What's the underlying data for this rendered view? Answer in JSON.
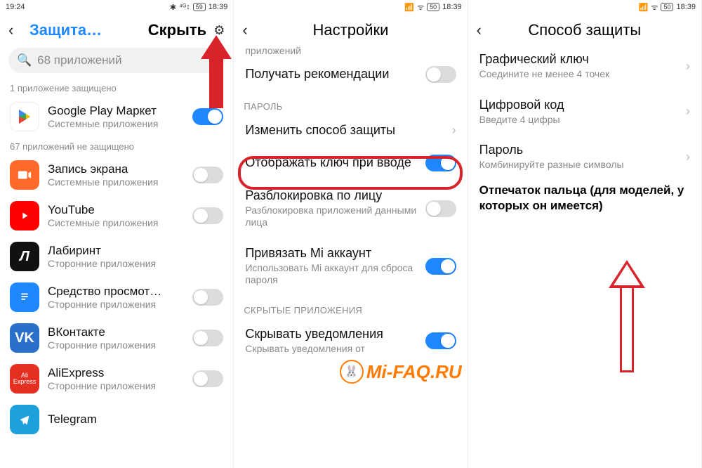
{
  "panel1": {
    "status": {
      "time_left": "19:24",
      "time_right": "18:39",
      "battery": "59"
    },
    "header": {
      "back": "‹",
      "tab_active": "Защита…",
      "tab_other": "Скрыть"
    },
    "search": {
      "placeholder": "68 приложений"
    },
    "protected_label": "1 приложение защищено",
    "unprotected_label": "67 приложений не защищено",
    "apps": [
      {
        "name": "Google Play Маркет",
        "sub": "Системные приложения",
        "toggle": true,
        "icon": "play"
      },
      {
        "name": "Запись экрана",
        "sub": "Системные приложения",
        "toggle": false,
        "icon": "rec"
      },
      {
        "name": "YouTube",
        "sub": "Системные приложения",
        "toggle": false,
        "icon": "yt"
      },
      {
        "name": "Лабиринт",
        "sub": "Сторонние приложения",
        "toggle": false,
        "icon": "lab"
      },
      {
        "name": "Средство просмот…",
        "sub": "Сторонние приложения",
        "toggle": false,
        "icon": "doc"
      },
      {
        "name": "ВКонтакте",
        "sub": "Сторонние приложения",
        "toggle": false,
        "icon": "vk"
      },
      {
        "name": "AliExpress",
        "sub": "Сторонние приложения",
        "toggle": false,
        "icon": "ali"
      },
      {
        "name": "Telegram",
        "sub": "",
        "toggle": false,
        "icon": "tg"
      }
    ]
  },
  "panel2": {
    "status": {
      "time": "18:39",
      "battery": "50"
    },
    "header": {
      "title": "Настройки"
    },
    "cut_top": "приложений",
    "items": {
      "recommend": {
        "title": "Получать рекомендации",
        "toggle": false
      },
      "section_pwd": "ПАРОЛЬ",
      "change_method": {
        "title": "Изменить способ защиты"
      },
      "show_key": {
        "title": "Отображать ключ при вводе",
        "toggle": true
      },
      "face": {
        "title": "Разблокировка по лицу",
        "sub": "Разблокировка приложений данными лица",
        "toggle": false
      },
      "mi_account": {
        "title": "Привязать Mi аккаунт",
        "sub": "Использовать Mi аккаунт для сброса пароля",
        "toggle": true
      },
      "section_hidden": "СКРЫТЫЕ ПРИЛОЖЕНИЯ",
      "hide_notif": {
        "title": "Скрывать уведомления",
        "sub": "Скрывать уведомления от"
      }
    },
    "logo": "Mi-FAQ.RU"
  },
  "panel3": {
    "status": {
      "time": "18:39",
      "battery": "50"
    },
    "header": {
      "title": "Способ защиты"
    },
    "options": [
      {
        "title": "Графический ключ",
        "sub": "Соедините не менее 4 точек"
      },
      {
        "title": "Цифровой код",
        "sub": "Введите 4 цифры"
      },
      {
        "title": "Пароль",
        "sub": "Комбинируйте разные символы"
      }
    ],
    "note": "Отпечаток пальца (для моделей, у которых он имеется)"
  }
}
